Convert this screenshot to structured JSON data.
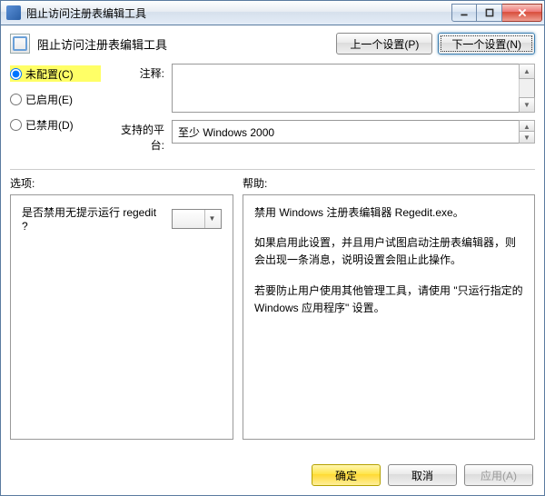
{
  "window": {
    "title": "阻止访问注册表编辑工具"
  },
  "header": {
    "title": "阻止访问注册表编辑工具",
    "prev": "上一个设置(P)",
    "next": "下一个设置(N)"
  },
  "radios": {
    "unconfigured": "未配置(C)",
    "enabled": "已启用(E)",
    "disabled": "已禁用(D)"
  },
  "fields": {
    "comment_label": "注释:",
    "platform_label": "支持的平台:",
    "platform_value": "至少 Windows 2000"
  },
  "section": {
    "options": "选项:",
    "help": "帮助:"
  },
  "options": {
    "question": "是否禁用无提示运行 regedit ?"
  },
  "help": {
    "p1": "禁用 Windows 注册表编辑器 Regedit.exe。",
    "p2": "如果启用此设置，并且用户试图启动注册表编辑器，则会出现一条消息，说明设置会阻止此操作。",
    "p3": "若要防止用户使用其他管理工具，请使用 \"只运行指定的 Windows 应用程序\" 设置。"
  },
  "footer": {
    "ok": "确定",
    "cancel": "取消",
    "apply": "应用(A)"
  }
}
